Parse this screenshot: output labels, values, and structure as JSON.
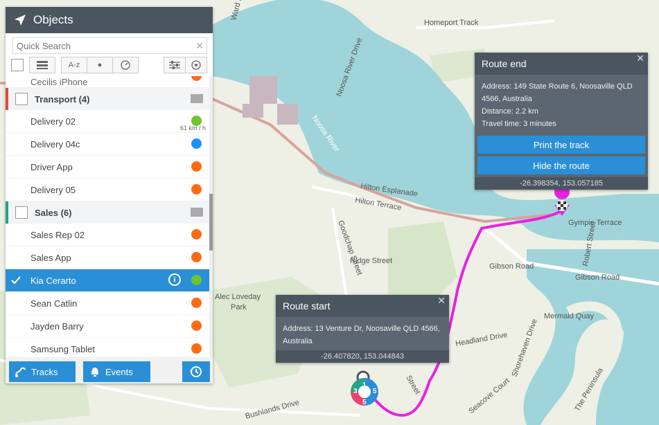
{
  "map": {
    "labels": [
      "Homeport Track",
      "Ward Street",
      "Noosa River Drive",
      "Noosa River",
      "Hilton Esplanade",
      "Hilton Terrace",
      "Goodchap Street",
      "Ridge Street",
      "Gibson Road",
      "Gibson Road",
      "Robert Street",
      "Gympie Terrace",
      "Mermaid Quay",
      "Headland Drive",
      "Shorehaven Drive",
      "Seacove Court",
      "The Peninsula",
      "Alec Loveday Park",
      "Bushlands Drive",
      "Street"
    ],
    "colors": {
      "water": "#9fd5da",
      "land": "#eef0e6",
      "route": "#e822e0",
      "road": "#d9a39e"
    },
    "cluster": {
      "a": "1",
      "b": "3",
      "c": "5",
      "d": "5"
    }
  },
  "objects_panel": {
    "title": "Objects",
    "search_placeholder": "Quick Search",
    "toolbar": {
      "sort_az": "A-z"
    },
    "partial_item": "Cecilis iPhone",
    "groups": [
      {
        "name": "Transport (4)",
        "color": "#e04b3e",
        "items": [
          {
            "name": "Delivery 02",
            "status": "#6cc72b",
            "speed": "61 km / h"
          },
          {
            "name": "Delivery 04c",
            "status": "#1e90ff"
          },
          {
            "name": "Driver App",
            "status": "#ff6a14"
          },
          {
            "name": "Delivery 05",
            "status": "#ff6a14"
          }
        ]
      },
      {
        "name": "Sales (6)",
        "color": "#24a28a",
        "items": [
          {
            "name": "Sales Rep 02",
            "status": "#ff6a14"
          },
          {
            "name": "Sales App",
            "status": "#ff6a14"
          },
          {
            "name": "Kia Cerarto",
            "status": "#6cc72b",
            "selected": true
          },
          {
            "name": "Sean Catlin",
            "status": "#ff6a14"
          },
          {
            "name": "Jayden Barry",
            "status": "#ff6a14"
          },
          {
            "name": "Samsung Tablet",
            "status": "#ff6a14"
          }
        ]
      }
    ],
    "buttons": {
      "tracks": "Tracks",
      "events": "Events"
    }
  },
  "route_end": {
    "title": "Route end",
    "address": "Address: 149 State Route 6, Noosaville QLD 4566, Australia",
    "distance": "Distance: 2.2 km",
    "travel_time": "Travel time: 3 minutes",
    "print_button": "Print the track",
    "hide_button": "Hide the route",
    "coords": "-26.398354, 153.057185"
  },
  "route_start": {
    "title": "Route start",
    "address": "Address: 13 Venture Dr, Noosaville QLD 4566, Australia",
    "coords": "-26.407820, 153.044843"
  }
}
